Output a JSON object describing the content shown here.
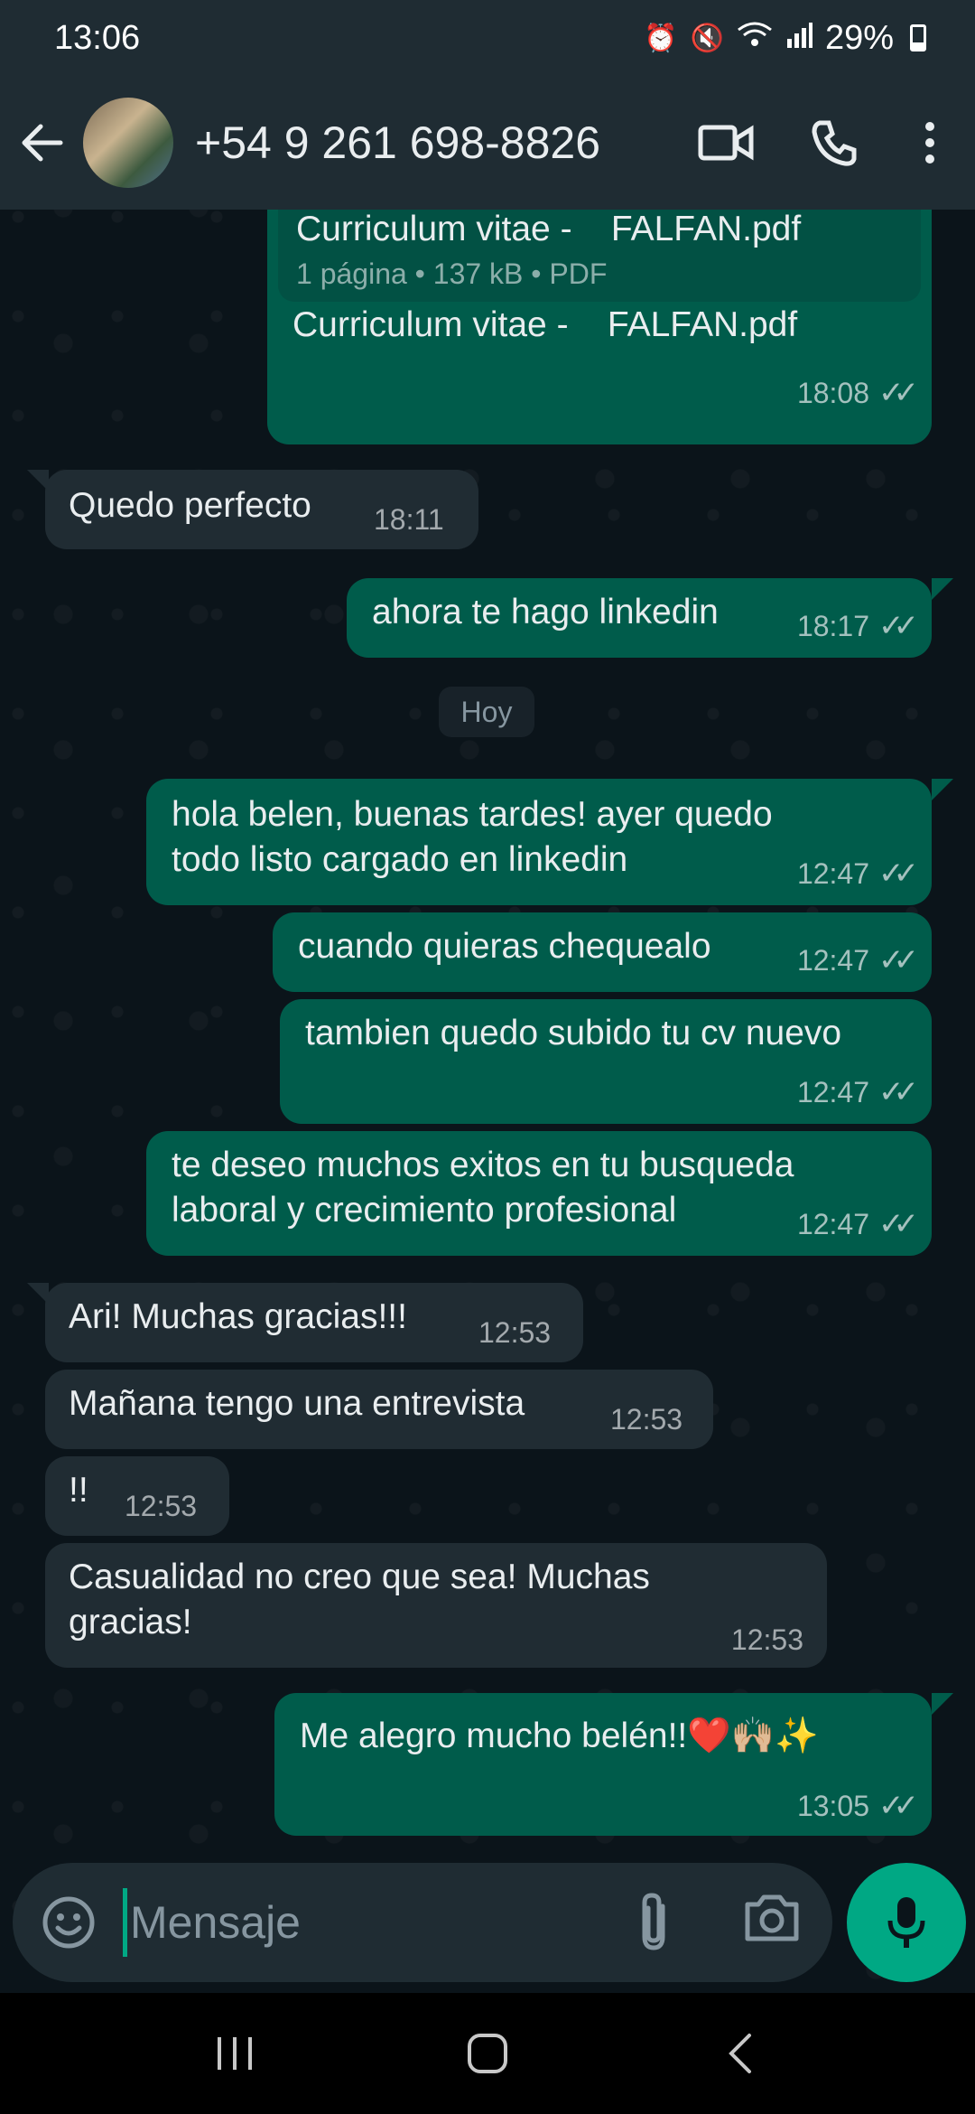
{
  "status_bar": {
    "time": "13:06",
    "battery": "29%"
  },
  "header": {
    "contact": "+54 9 261 698-8826"
  },
  "document": {
    "name": "Curriculum vitae -    FALFAN.pdf",
    "info": "1 página • 137 kB • PDF",
    "caption": "Curriculum vitae -    FALFAN.pdf",
    "time": "18:08"
  },
  "messages": [
    {
      "dir": "in",
      "lines": [
        "Quedo perfecto"
      ],
      "time": "18:11"
    },
    {
      "dir": "out",
      "lines": [
        "ahora te hago linkedin"
      ],
      "time": "18:17"
    },
    {
      "dir": "out",
      "lines": [
        "hola belen, buenas tardes! ayer quedo",
        "todo listo cargado en linkedin"
      ],
      "time": "12:47"
    },
    {
      "dir": "out",
      "lines": [
        "cuando quieras chequealo"
      ],
      "time": "12:47"
    },
    {
      "dir": "out",
      "lines": [
        "tambien quedo subido tu cv nuevo"
      ],
      "time": "12:47"
    },
    {
      "dir": "out",
      "lines": [
        "te deseo muchos exitos en tu busqueda",
        "laboral y crecimiento profesional"
      ],
      "time": "12:47"
    },
    {
      "dir": "in",
      "lines": [
        "Ari! Muchas gracias!!!"
      ],
      "time": "12:53"
    },
    {
      "dir": "in",
      "lines": [
        "Mañana tengo una entrevista"
      ],
      "time": "12:53"
    },
    {
      "dir": "in",
      "lines": [
        "!!"
      ],
      "time": "12:53"
    },
    {
      "dir": "in",
      "lines": [
        "Casualidad no creo que sea! Muchas",
        "gracias!"
      ],
      "time": "12:53"
    },
    {
      "dir": "out",
      "lines": [
        "Me alegro mucho belén!!❤️🙌🏼✨"
      ],
      "time": "13:05"
    }
  ],
  "date_separator": "Hoy",
  "input": {
    "placeholder": "Mensaje"
  },
  "icons": {
    "back": "arrow-back-icon",
    "video": "video-call-icon",
    "call": "phone-icon",
    "menu": "more-vert-icon",
    "emoji": "emoji-icon",
    "attach": "paperclip-icon",
    "camera": "camera-icon",
    "mic": "microphone-icon"
  },
  "colors": {
    "outgoing": "#005c4b",
    "incoming": "#202c33",
    "accent": "#00a884",
    "header": "#1f2c33"
  }
}
